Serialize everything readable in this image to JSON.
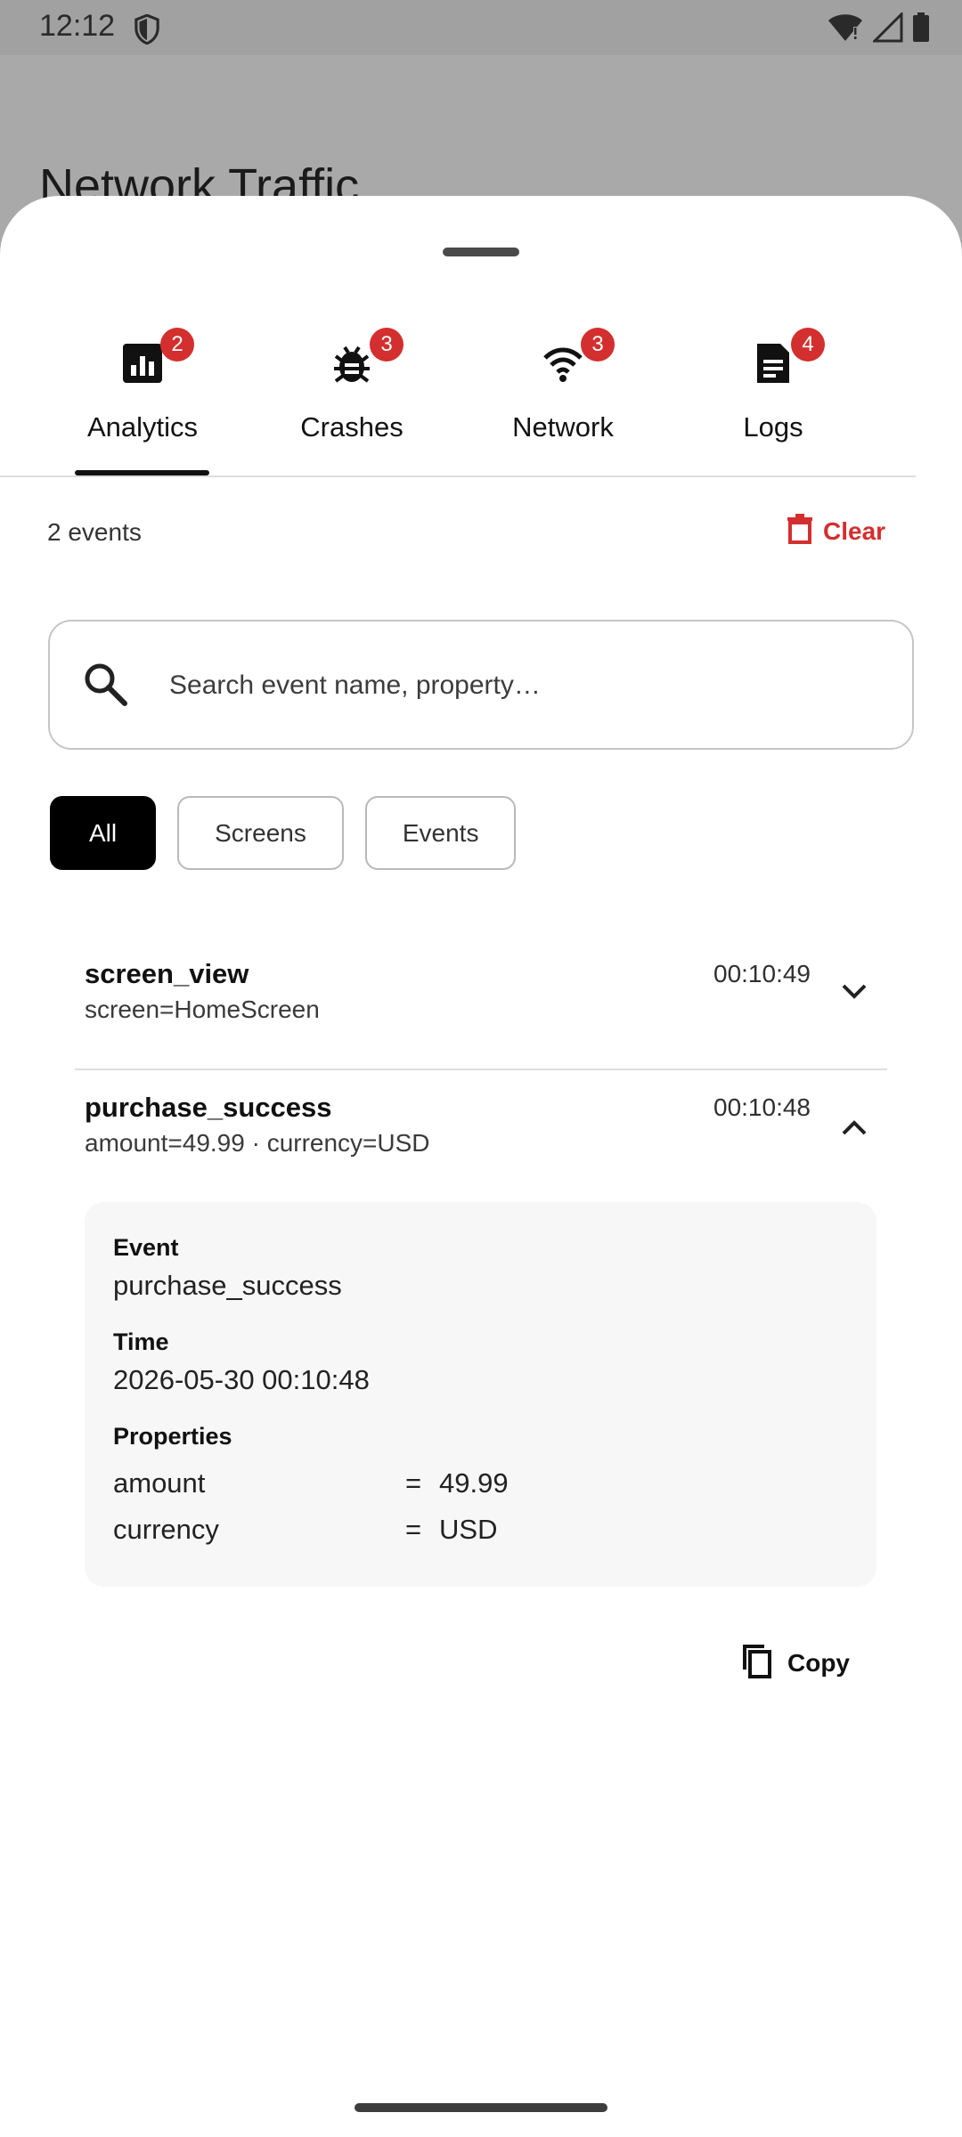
{
  "status_bar": {
    "time": "12:12"
  },
  "background": {
    "title": "Network Traffic"
  },
  "tabs": [
    {
      "label": "Analytics",
      "badge": "2",
      "icon": "bar-chart-icon"
    },
    {
      "label": "Crashes",
      "badge": "3",
      "icon": "bug-icon"
    },
    {
      "label": "Network",
      "badge": "3",
      "icon": "wifi-icon"
    },
    {
      "label": "Logs",
      "badge": "4",
      "icon": "document-icon"
    }
  ],
  "header": {
    "event_count": "2 events",
    "clear_label": "Clear"
  },
  "search": {
    "placeholder": "Search event name, property…"
  },
  "filters": {
    "chips": [
      "All",
      "Screens",
      "Events"
    ],
    "selected": "All"
  },
  "events": [
    {
      "name": "screen_view",
      "summary": "screen=HomeScreen",
      "time": "00:10:49",
      "expanded": false
    },
    {
      "name": "purchase_success",
      "summary": "amount=49.99 · currency=USD",
      "time": "00:10:48",
      "expanded": true
    }
  ],
  "details": {
    "event_label": "Event",
    "event_value": "purchase_success",
    "time_label": "Time",
    "time_value": "2026-05-30 00:10:48",
    "properties_label": "Properties",
    "properties": [
      {
        "key": "amount",
        "eq": "=",
        "value": "49.99"
      },
      {
        "key": "currency",
        "eq": "=",
        "value": "USD"
      }
    ]
  },
  "copy_label": "Copy",
  "colors": {
    "accent_red": "#d32f2f",
    "selected_chip": "#000000",
    "sheet": "#ffffff",
    "scrim": "#a9a9a9"
  }
}
